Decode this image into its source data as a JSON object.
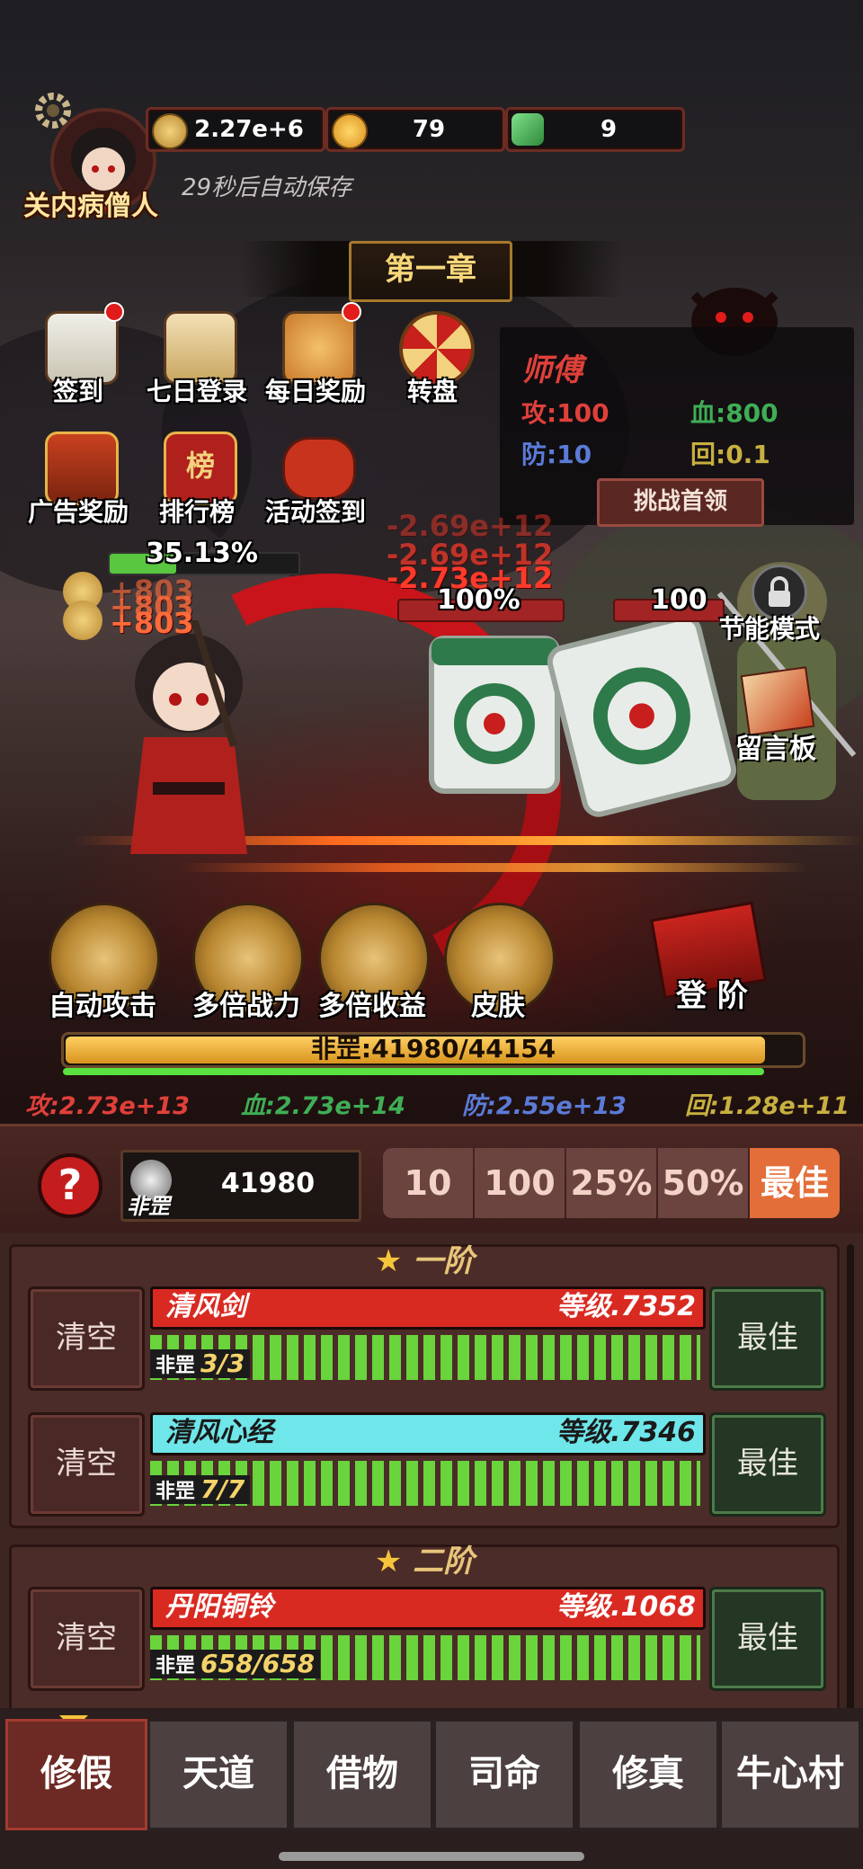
{
  "player": {
    "name": "关内病僧人",
    "autosave": "29秒后自动保存"
  },
  "resources": [
    {
      "icon": "copper-coin-icon",
      "value": "2.27e+6"
    },
    {
      "icon": "longevity-coin-icon",
      "value": "79"
    },
    {
      "icon": "jade-icon",
      "value": "9"
    }
  ],
  "chapter": "第一章",
  "menu": [
    {
      "label": "签到",
      "badge": true
    },
    {
      "label": "七日登录",
      "badge": false
    },
    {
      "label": "每日奖励",
      "badge": true
    },
    {
      "label": "转盘",
      "badge": false
    },
    {
      "label": "广告奖励",
      "badge": false
    },
    {
      "label": "排行榜",
      "badge": false
    },
    {
      "label": "活动签到",
      "badge": false
    }
  ],
  "leaderboard_glyph": "榜",
  "boss": {
    "name": "师傅",
    "atk": "攻:100",
    "hp": "血:800",
    "def": "防:10",
    "regen": "回:0.1",
    "challenge": "挑战首领"
  },
  "battle": {
    "player_pct": "35.13%",
    "player_pct_value": 0.3513,
    "enemy1_pct": "100%",
    "enemy2_pct": "100",
    "damage": [
      "-2.69e+12",
      "-2.69e+12",
      "-2.73e+12"
    ],
    "gains": [
      "+803",
      "+803",
      "+803"
    ]
  },
  "side_buttons": {
    "power_save": "节能模式",
    "message_board": "留言板"
  },
  "skills": [
    "自动攻击",
    "多倍战力",
    "多倍收益",
    "皮肤"
  ],
  "ascend": "登 阶",
  "exp": {
    "text": "非罡:41980/44154",
    "value": 41980,
    "max": 44154
  },
  "stats": {
    "atk": "攻:2.73e+13",
    "hp": "血:2.73e+14",
    "def": "防:2.55e+13",
    "regen": "回:1.28e+11"
  },
  "colors": {
    "atk": "#e0403a",
    "hp": "#3fae55",
    "def": "#5b7bd8",
    "regen": "#c8b040"
  },
  "currency": {
    "label": "非罡",
    "value": "41980"
  },
  "amounts": [
    "10",
    "100",
    "25%",
    "50%",
    "最佳"
  ],
  "tiers": [
    {
      "title": "一阶",
      "items": [
        {
          "name": "清风剑",
          "level": "等级.7352",
          "count_label": "非罡",
          "count": "3/3",
          "color": "#d92a22",
          "clear": "清空",
          "best": "最佳"
        },
        {
          "name": "清风心经",
          "level": "等级.7346",
          "count_label": "非罡",
          "count": "7/7",
          "color": "#6ee6ea",
          "clear": "清空",
          "best": "最佳"
        }
      ]
    },
    {
      "title": "二阶",
      "items": [
        {
          "name": "丹阳铜铃",
          "level": "等级.1068",
          "count_label": "非罡",
          "count": "658/658",
          "color": "#d92a22",
          "clear": "清空",
          "best": "最佳"
        }
      ]
    }
  ],
  "nav": [
    "修假",
    "天道",
    "借物",
    "司命",
    "修真",
    "牛心村"
  ]
}
